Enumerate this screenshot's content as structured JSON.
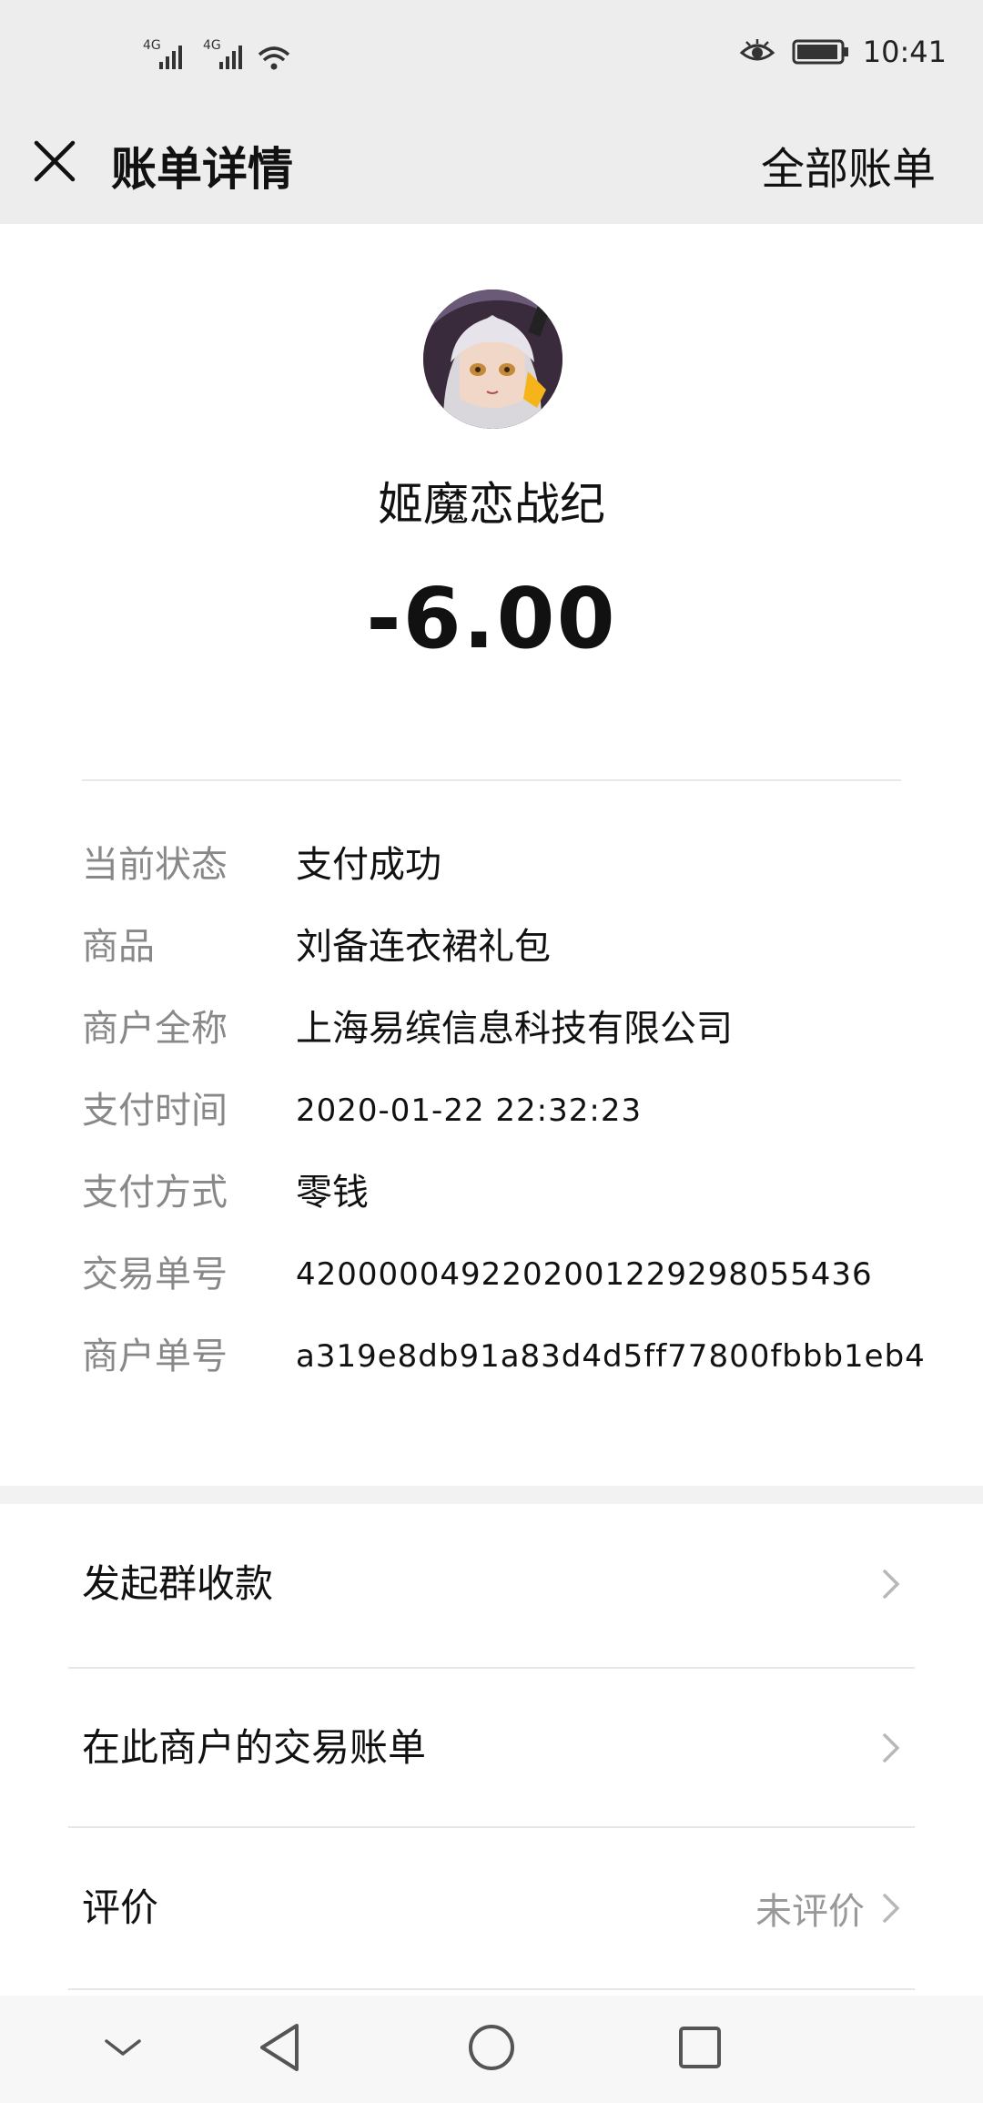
{
  "status_bar": {
    "time": "10:41",
    "network_left_1": "4G",
    "network_left_2": "4G",
    "icons": [
      "signal-icon",
      "signal-icon",
      "wifi-icon",
      "eye-icon",
      "battery-icon"
    ]
  },
  "header": {
    "title": "账单详情",
    "right_action": "全部账单",
    "close_icon": "close-icon"
  },
  "merchant": {
    "name": "姬魔恋战纪",
    "amount": "-6.00"
  },
  "details": [
    {
      "label": "当前状态",
      "value": "支付成功"
    },
    {
      "label": "商品",
      "value": "刘备连衣裙礼包"
    },
    {
      "label": "商户全称",
      "value": "上海易缤信息科技有限公司"
    },
    {
      "label": "支付时间",
      "value": "2020-01-22 22:32:23"
    },
    {
      "label": "支付方式",
      "value": "零钱"
    },
    {
      "label": "交易单号",
      "value": "4200000492202001229298055436"
    },
    {
      "label": "商户单号",
      "value": "a319e8db91a83d4d5ff77800fbbb1eb4"
    }
  ],
  "menu": [
    {
      "label": "发起群收款",
      "value": ""
    },
    {
      "label": "在此商户的交易账单",
      "value": ""
    },
    {
      "label": "评价",
      "value": "未评价"
    }
  ],
  "nav": {
    "icons": [
      "chevron-down-icon",
      "back-icon",
      "home-icon",
      "recents-icon"
    ]
  },
  "colors": {
    "bar_bg": "#ededed",
    "label_gray": "#888888",
    "text": "#111111"
  }
}
